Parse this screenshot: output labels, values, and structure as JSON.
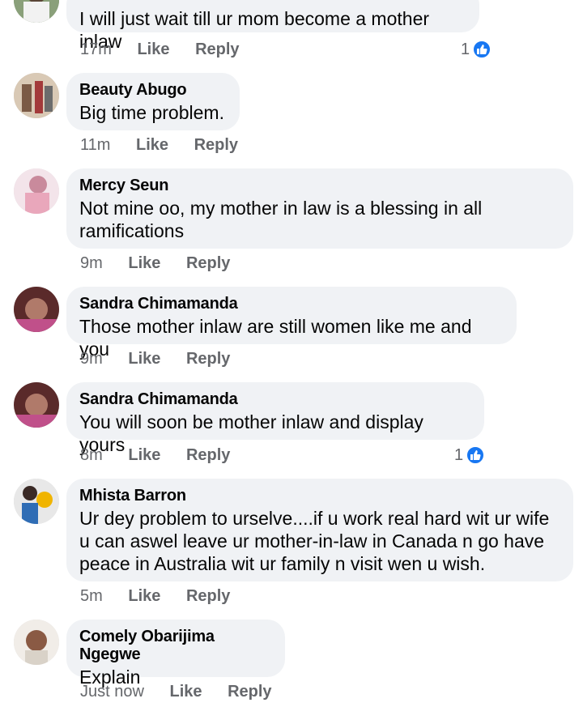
{
  "comments": [
    {
      "author": "",
      "text": "I will just wait till ur mom become a mother inlaw",
      "time": "17m",
      "like": "Like",
      "reply": "Reply",
      "reactions": "1"
    },
    {
      "author": "Beauty Abugo",
      "text": "Big time problem.",
      "time": "11m",
      "like": "Like",
      "reply": "Reply",
      "reactions": ""
    },
    {
      "author": "Mercy Seun",
      "text": "Not mine oo, my mother in law is a blessing in all ramifications",
      "time": "9m",
      "like": "Like",
      "reply": "Reply",
      "reactions": ""
    },
    {
      "author": "Sandra Chimamanda",
      "text": "Those mother inlaw are still women like me and you",
      "time": "9m",
      "like": "Like",
      "reply": "Reply",
      "reactions": ""
    },
    {
      "author": "Sandra Chimamanda",
      "text": "You will soon be mother inlaw and display yours",
      "time": "8m",
      "like": "Like",
      "reply": "Reply",
      "reactions": "1"
    },
    {
      "author": "Mhista Barron",
      "text": "Ur dey problem to urselve....if u work real hard wit ur wife u can aswel leave ur mother-in-law in Canada n go have peace in Australia wit ur family n visit wen u wish.",
      "time": "5m",
      "like": "Like",
      "reply": "Reply",
      "reactions": ""
    },
    {
      "author": "Comely Obarijima Ngegwe",
      "text": "Explain",
      "time": "Just now",
      "like": "Like",
      "reply": "Reply",
      "reactions": ""
    }
  ],
  "colors": {
    "bubble": "#f0f2f5",
    "meta": "#65676b",
    "like_badge": "#1877f2"
  },
  "icons": {
    "reaction": "like-thumbs-up-icon"
  }
}
